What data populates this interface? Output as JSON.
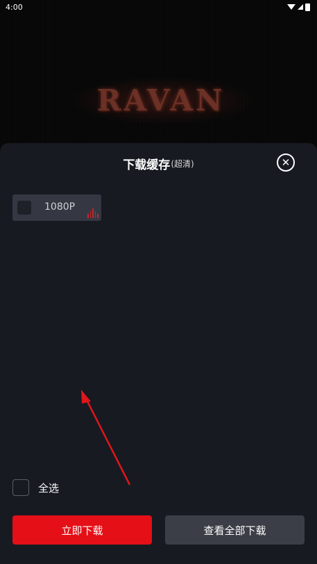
{
  "status_bar": {
    "time": "4:00"
  },
  "video": {
    "logo_text": "RAVAN"
  },
  "sheet": {
    "title": "下载缓存",
    "subtitle": "(超清)",
    "close_symbol": "✕"
  },
  "quality_options": [
    {
      "label": "1080P",
      "checked": false,
      "icon": "audio-wave-icon"
    }
  ],
  "select_all": {
    "label": "全选",
    "checked": false
  },
  "buttons": {
    "download_now": "立即下载",
    "view_all_downloads": "查看全部下载"
  },
  "colors": {
    "accent": "#e50f17",
    "sheet_bg": "#171a21",
    "option_bg": "#353842",
    "secondary_button": "#3b3e46"
  }
}
